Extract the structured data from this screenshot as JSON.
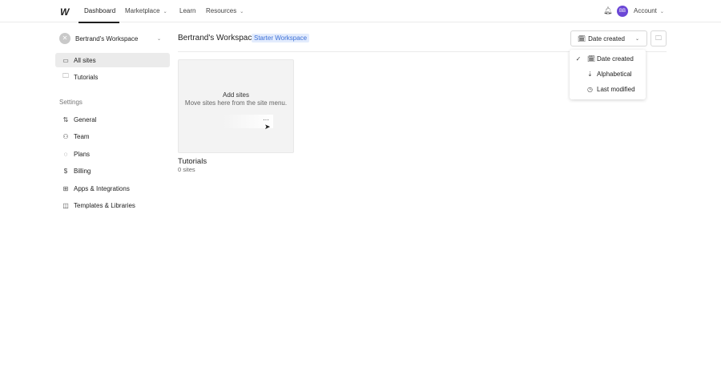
{
  "topnav": {
    "logo": "W",
    "items": [
      "Dashboard",
      "Marketplace",
      "Learn",
      "Resources"
    ],
    "avatar": "BB",
    "account": "Account"
  },
  "sidebar": {
    "workspace": "Bertrand's Workspace",
    "items": [
      "All sites",
      "Tutorials"
    ],
    "settings_label": "Settings",
    "settings": [
      "General",
      "Team",
      "Plans",
      "Billing",
      "Apps & Integrations",
      "Templates & Libraries"
    ]
  },
  "main": {
    "title": "Bertrand's Workspace",
    "badge": "Starter Workspace",
    "sort": "Date created",
    "folder": {
      "empty_title": "Add sites",
      "empty_text": "Move sites here from the site menu.",
      "more": "···",
      "name": "Tutorials",
      "count": "0 sites"
    }
  },
  "sort_menu": {
    "items": [
      "Date created",
      "Alphabetical",
      "Last modified"
    ],
    "checked": "✓"
  },
  "colors": {
    "avatar": "#6b47d6",
    "badge_bg": "#e3ecfd",
    "badge_text": "#3b6fd6"
  }
}
